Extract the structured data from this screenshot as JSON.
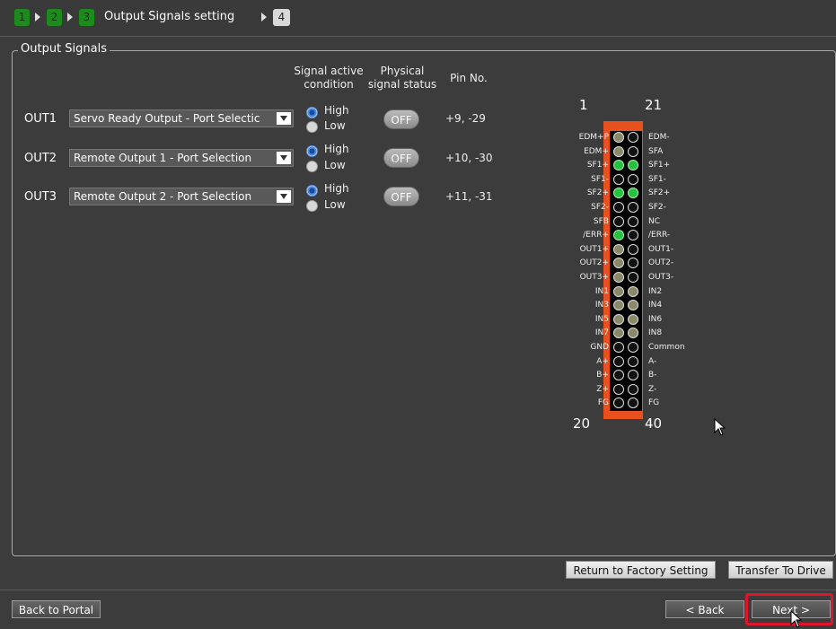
{
  "breadcrumb": {
    "steps": [
      "1",
      "2",
      "3",
      "4"
    ],
    "current_title": "Output Signals setting"
  },
  "group_title": "Output Signals",
  "headers": {
    "signal_active_line1": "Signal active",
    "signal_active_line2": "condition",
    "physical_line1": "Physical",
    "physical_line2": "signal status",
    "pin_no": "Pin No."
  },
  "outputs": [
    {
      "label": "OUT1",
      "selection": "Servo Ready Output - Port Selectic",
      "high": "High",
      "low": "Low",
      "active": "High",
      "status": "OFF",
      "pins": "+9, -29"
    },
    {
      "label": "OUT2",
      "selection": "Remote Output 1 - Port Selection",
      "high": "High",
      "low": "Low",
      "active": "High",
      "status": "OFF",
      "pins": "+10, -30"
    },
    {
      "label": "OUT3",
      "selection": "Remote Output 2 - Port Selection",
      "high": "High",
      "low": "Low",
      "active": "High",
      "status": "OFF",
      "pins": "+11, -31"
    }
  ],
  "connector": {
    "top_left": "1",
    "top_right": "21",
    "bottom_left": "20",
    "bottom_right": "40",
    "left_labels": [
      "EDM+P",
      "EDM+",
      "SF1+",
      "SF1-",
      "SF2+",
      "SF2-",
      "SFB",
      "/ERR+",
      "OUT1+",
      "OUT2+",
      "OUT3+",
      "IN1",
      "IN3",
      "IN5",
      "IN7",
      "GND",
      "A+",
      "B+",
      "Z+",
      "FG"
    ],
    "right_labels": [
      "EDM-",
      "SFA",
      "SF1+",
      "SF1-",
      "SF2+",
      "SF2-",
      "NC",
      "/ERR-",
      "OUT1-",
      "OUT2-",
      "OUT3-",
      "IN2",
      "IN4",
      "IN6",
      "IN8",
      "Common",
      "A-",
      "B-",
      "Z-",
      "FG"
    ],
    "left_states": [
      "k",
      "k",
      "g",
      "o",
      "g",
      "o",
      "o",
      "g",
      "k",
      "k",
      "k",
      "k",
      "k",
      "k",
      "k",
      "o",
      "o",
      "o",
      "o",
      "o"
    ],
    "right_states": [
      "o",
      "o",
      "g",
      "o",
      "g",
      "o",
      "o",
      "o",
      "o",
      "o",
      "o",
      "k",
      "k",
      "k",
      "k",
      "o",
      "o",
      "o",
      "o",
      "o"
    ],
    "state_legend": {
      "g": "lit green",
      "k": "grey",
      "o": "off"
    }
  },
  "buttons": {
    "return_factory": "Return to Factory Setting",
    "transfer": "Transfer To Drive",
    "back_portal": "Back to Portal",
    "back": "< Back",
    "next": "Next >"
  }
}
